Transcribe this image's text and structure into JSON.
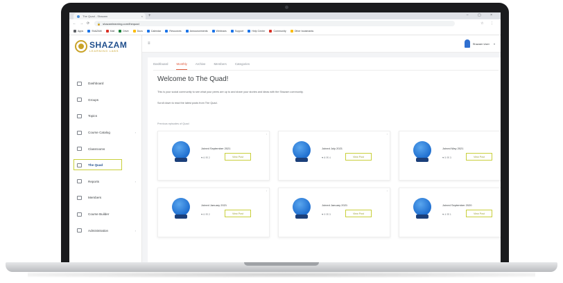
{
  "browser": {
    "tab_title": "The Quad - Shazam",
    "tab_close": "×",
    "new_tab": "+",
    "window_controls": "– ▢ ×",
    "nav": {
      "back": "←",
      "forward": "→",
      "reload": "⟳"
    },
    "url": "shazamlearning.com/thequad",
    "toolbar_icons": "☆ ⋮",
    "bookmarks": [
      {
        "label": "Apps",
        "color": "#5f6368"
      },
      {
        "label": "ShAZAM",
        "color": "#1a73e8"
      },
      {
        "label": "Mail",
        "color": "#d93025"
      },
      {
        "label": "Drive",
        "color": "#188038"
      },
      {
        "label": "Docs",
        "color": "#fbbc04"
      },
      {
        "label": "Calendar",
        "color": "#1a73e8"
      },
      {
        "label": "Resources",
        "color": "#1a73e8"
      },
      {
        "label": "Announcements",
        "color": "#1a73e8"
      },
      {
        "label": "Webinars",
        "color": "#1a73e8"
      },
      {
        "label": "Support",
        "color": "#1a73e8"
      },
      {
        "label": "Help Center",
        "color": "#1a73e8"
      },
      {
        "label": "Community",
        "color": "#d93025"
      },
      {
        "label": "Other bookmarks",
        "color": "#fbbc04"
      }
    ]
  },
  "sidebar": {
    "logo_name": "SHAZAM",
    "logo_tagline": "LEARNING LABS",
    "items": [
      {
        "label": "Dashboard",
        "caret": ""
      },
      {
        "label": "Groups",
        "caret": ""
      },
      {
        "label": "Topics",
        "caret": ""
      },
      {
        "label": "Course Catalog",
        "caret": "›"
      },
      {
        "label": "Classrooms",
        "caret": ""
      },
      {
        "label": "The Quad",
        "caret": ""
      },
      {
        "label": "Reports",
        "caret": "›"
      },
      {
        "label": "Members",
        "caret": ""
      },
      {
        "label": "Course Builder",
        "caret": ""
      },
      {
        "label": "Administration",
        "caret": "›"
      }
    ],
    "active_index": 5
  },
  "topbar": {
    "menu_icon": "≡",
    "user_name": "Shazam User",
    "user_caret": "▾"
  },
  "main": {
    "subtabs": [
      "Dashboard",
      "Monthly",
      "Archive",
      "Members",
      "Categories"
    ],
    "active_subtab": 1,
    "welcome_title": "Welcome to The Quad!",
    "welcome_text": "This is your social community to see what your peers are up to and share your stories and ideas with the Shazam community.",
    "welcome_note": "Scroll down to read the latest posts from The Quad.",
    "section_label": "Previous episodes of Quad",
    "cards": [
      {
        "title": "Joined September 2021",
        "stats": "♥ 6   ✉ 2",
        "button": "View Post"
      },
      {
        "title": "Joined July 2021",
        "stats": "♥ 8   ✉ 4",
        "button": "View Post"
      },
      {
        "title": "Joined May 2021",
        "stats": "♥ 5   ✉ 3",
        "button": "View Post"
      },
      {
        "title": "Joined January 2021",
        "stats": "♥ 6   ✉ 2",
        "button": "View Post"
      },
      {
        "title": "Joined January 2021",
        "stats": "♥ 9   ✉ 3",
        "button": "View Post"
      },
      {
        "title": "Joined September 2020",
        "stats": "♥ 4   ✉ 1",
        "button": "View Post"
      }
    ]
  }
}
